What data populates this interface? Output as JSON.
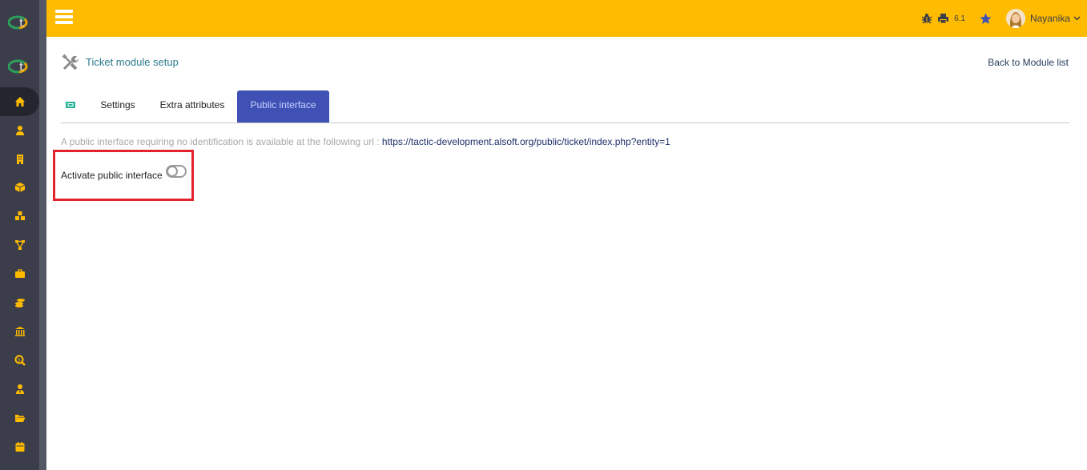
{
  "header": {
    "version": "6.1",
    "username": "Nayanika"
  },
  "page": {
    "title": "Ticket module setup",
    "back_link": "Back to Module list"
  },
  "tabs": [
    {
      "label": ""
    },
    {
      "label": "Settings"
    },
    {
      "label": "Extra attributes"
    },
    {
      "label": "Public interface",
      "active": true
    }
  ],
  "public_interface": {
    "info_text": "A public interface requiring no identification is available at the following url : ",
    "url": "https://tactic-development.alsoft.org/public/ticket/index.php?entity=1",
    "activate_label": "Activate public interface",
    "activated": false
  },
  "sidebar": {
    "items": [
      "home-icon",
      "user-icon",
      "building-icon",
      "box-icon",
      "cubes-icon",
      "sitemap-icon",
      "briefcase-icon",
      "coins-icon",
      "bank-icon",
      "search-dollar-icon",
      "user-tie-icon",
      "folder-open-icon",
      "calendar-icon"
    ]
  },
  "colors": {
    "topbar": "#ffbb00",
    "sidebar": "#3b3e4a",
    "sidebar_icon": "#ffbb00",
    "active_tab": "#3f51b5",
    "highlight": "#e4222c"
  }
}
